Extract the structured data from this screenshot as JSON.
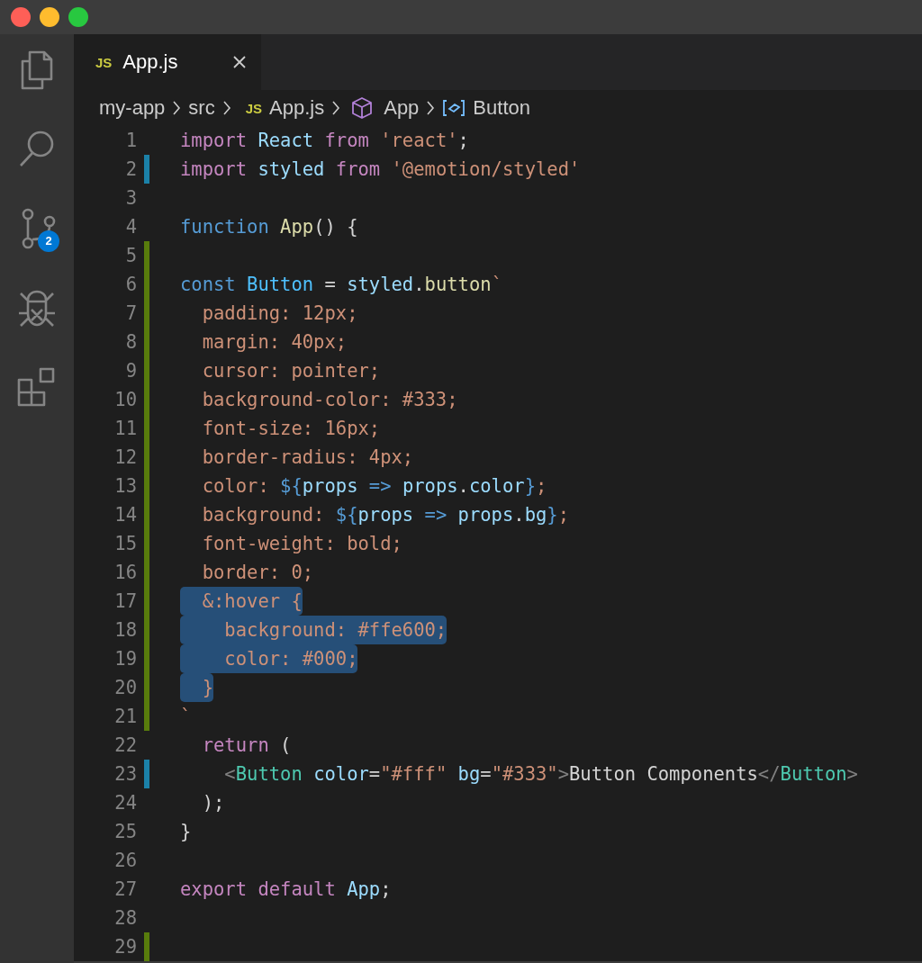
{
  "window": {
    "controls": [
      {
        "kind": "close"
      },
      {
        "kind": "minimize"
      },
      {
        "kind": "zoom"
      }
    ]
  },
  "activity_bar": [
    {
      "kind": "files"
    },
    {
      "kind": "search"
    },
    {
      "kind": "source-control",
      "badge": "2"
    },
    {
      "kind": "debug"
    },
    {
      "kind": "extensions"
    }
  ],
  "tabs": [
    {
      "badge": "JS",
      "label": "App.js",
      "selected": true
    }
  ],
  "breadcrumb": [
    {
      "kind": "folder",
      "label": "my-app"
    },
    {
      "kind": "folder",
      "label": "src"
    },
    {
      "kind": "file",
      "badge": "JS",
      "label": "App.js"
    },
    {
      "kind": "class",
      "label": "App"
    },
    {
      "kind": "variable",
      "label": "Button"
    }
  ],
  "editor": {
    "lines": [
      {
        "number": "1",
        "selected": false,
        "tokens": [
          {
            "text": "import ",
            "kind": "kw"
          },
          {
            "text": "React ",
            "kind": "var"
          },
          {
            "text": "from ",
            "kind": "kw"
          },
          {
            "text": "'react'",
            "kind": "str"
          },
          {
            "text": ";",
            "kind": "pl"
          }
        ]
      },
      {
        "number": "2",
        "color": "#1b81a8",
        "selected": false,
        "tokens": [
          {
            "text": "import ",
            "kind": "kw"
          },
          {
            "text": "styled ",
            "kind": "var"
          },
          {
            "text": "from ",
            "kind": "kw"
          },
          {
            "text": "'@emotion/styled'",
            "kind": "str"
          }
        ]
      },
      {
        "number": "3",
        "selected": false
      },
      {
        "number": "4",
        "selected": false,
        "tokens": [
          {
            "text": "function ",
            "kind": "st"
          },
          {
            "text": "App",
            "kind": "fn"
          },
          {
            "text": "() {",
            "kind": "pl"
          }
        ]
      },
      {
        "number": "5",
        "color": "#587c0c",
        "selected": false
      },
      {
        "number": "6",
        "color": "#587c0c",
        "selected": false,
        "tokens": [
          {
            "text": "const ",
            "kind": "st"
          },
          {
            "text": "Button",
            "kind": "cn"
          },
          {
            "text": " = ",
            "kind": "pl"
          },
          {
            "text": "styled",
            "kind": "var"
          },
          {
            "text": ".",
            "kind": "pl"
          },
          {
            "text": "button",
            "kind": "fn"
          },
          {
            "text": "`",
            "kind": "str"
          }
        ]
      },
      {
        "number": "7",
        "color": "#587c0c",
        "selected": false,
        "tokens": [
          {
            "text": "  padding: 12px;",
            "kind": "str"
          }
        ]
      },
      {
        "number": "8",
        "color": "#587c0c",
        "selected": false,
        "tokens": [
          {
            "text": "  margin: 40px;",
            "kind": "str"
          }
        ]
      },
      {
        "number": "9",
        "color": "#587c0c",
        "selected": false,
        "tokens": [
          {
            "text": "  cursor: pointer;",
            "kind": "str"
          }
        ]
      },
      {
        "number": "10",
        "color": "#587c0c",
        "selected": false,
        "tokens": [
          {
            "text": "  background-color: #333;",
            "kind": "str"
          }
        ]
      },
      {
        "number": "11",
        "color": "#587c0c",
        "selected": false,
        "tokens": [
          {
            "text": "  font-size: 16px;",
            "kind": "str"
          }
        ]
      },
      {
        "number": "12",
        "color": "#587c0c",
        "selected": false,
        "tokens": [
          {
            "text": "  border-radius: 4px;",
            "kind": "str"
          }
        ]
      },
      {
        "number": "13",
        "color": "#587c0c",
        "selected": false,
        "tokens": [
          {
            "text": "  color: ",
            "kind": "str"
          },
          {
            "text": "${",
            "kind": "st"
          },
          {
            "text": "props",
            "kind": "var"
          },
          {
            "text": " => ",
            "kind": "st"
          },
          {
            "text": "props",
            "kind": "var"
          },
          {
            "text": ".",
            "kind": "pl"
          },
          {
            "text": "color",
            "kind": "var"
          },
          {
            "text": "}",
            "kind": "st"
          },
          {
            "text": ";",
            "kind": "str"
          }
        ]
      },
      {
        "number": "14",
        "color": "#587c0c",
        "selected": false,
        "tokens": [
          {
            "text": "  background: ",
            "kind": "str"
          },
          {
            "text": "${",
            "kind": "st"
          },
          {
            "text": "props",
            "kind": "var"
          },
          {
            "text": " => ",
            "kind": "st"
          },
          {
            "text": "props",
            "kind": "var"
          },
          {
            "text": ".",
            "kind": "pl"
          },
          {
            "text": "bg",
            "kind": "var"
          },
          {
            "text": "}",
            "kind": "st"
          },
          {
            "text": ";",
            "kind": "str"
          }
        ]
      },
      {
        "number": "15",
        "color": "#587c0c",
        "selected": false,
        "tokens": [
          {
            "text": "  font-weight: bold;",
            "kind": "str"
          }
        ]
      },
      {
        "number": "16",
        "color": "#587c0c",
        "selected": false,
        "tokens": [
          {
            "text": "  border: 0;",
            "kind": "str"
          }
        ]
      },
      {
        "number": "17",
        "color": "#587c0c",
        "selected": true,
        "tokens": [
          {
            "text": "  &:hover {",
            "kind": "str"
          }
        ]
      },
      {
        "number": "18",
        "color": "#587c0c",
        "selected": true,
        "tokens": [
          {
            "text": "    background: #ffe600;",
            "kind": "str"
          }
        ]
      },
      {
        "number": "19",
        "color": "#587c0c",
        "selected": true,
        "tokens": [
          {
            "text": "    color: #000;",
            "kind": "str"
          }
        ]
      },
      {
        "number": "20",
        "color": "#587c0c",
        "selected": true,
        "tokens": [
          {
            "text": "  }",
            "kind": "str"
          }
        ]
      },
      {
        "number": "21",
        "color": "#587c0c",
        "selected": false,
        "tokens": [
          {
            "text": "`",
            "kind": "str"
          }
        ]
      },
      {
        "number": "22",
        "selected": false,
        "tokens": [
          {
            "text": "  return",
            "kind": "kw"
          },
          {
            "text": " (",
            "kind": "pl"
          }
        ]
      },
      {
        "number": "23",
        "color": "#1b81a8",
        "selected": false,
        "tokens": [
          {
            "text": "    <",
            "kind": "tp"
          },
          {
            "text": "Button ",
            "kind": "tag"
          },
          {
            "text": "color",
            "kind": "var"
          },
          {
            "text": "=",
            "kind": "pl"
          },
          {
            "text": "\"#fff\" ",
            "kind": "str"
          },
          {
            "text": "bg",
            "kind": "var"
          },
          {
            "text": "=",
            "kind": "pl"
          },
          {
            "text": "\"#333\"",
            "kind": "str"
          },
          {
            "text": ">",
            "kind": "tp"
          },
          {
            "text": "Button Components",
            "kind": "pl"
          },
          {
            "text": "</",
            "kind": "tp"
          },
          {
            "text": "Button",
            "kind": "tag"
          },
          {
            "text": ">",
            "kind": "tp"
          }
        ]
      },
      {
        "number": "24",
        "selected": false,
        "tokens": [
          {
            "text": "  );",
            "kind": "pl"
          }
        ]
      },
      {
        "number": "25",
        "selected": false,
        "tokens": [
          {
            "text": "}",
            "kind": "pl"
          }
        ]
      },
      {
        "number": "26",
        "selected": false
      },
      {
        "number": "27",
        "selected": false,
        "tokens": [
          {
            "text": "export ",
            "kind": "kw"
          },
          {
            "text": "default ",
            "kind": "kw"
          },
          {
            "text": "App",
            "kind": "var"
          },
          {
            "text": ";",
            "kind": "pl"
          }
        ]
      },
      {
        "number": "28",
        "selected": false
      },
      {
        "number": "29",
        "color": "#587c0c",
        "selected": false
      }
    ]
  }
}
